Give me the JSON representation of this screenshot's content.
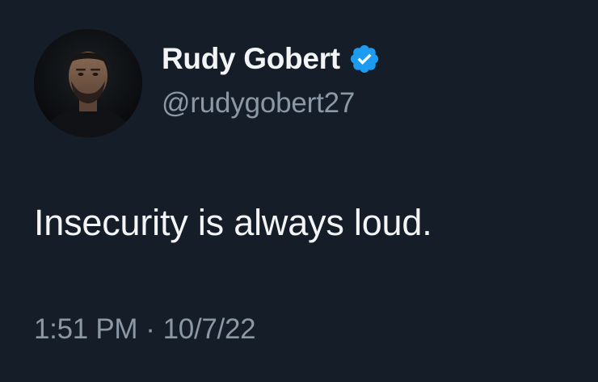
{
  "author": {
    "display_name": "Rudy Gobert",
    "handle": "@rudygobert27",
    "verified_icon": "verified-badge-icon",
    "avatar": "profile-photo"
  },
  "tweet": {
    "text": "Insecurity is always loud."
  },
  "meta": {
    "time": "1:51 PM",
    "separator": "·",
    "date": "10/7/22"
  },
  "colors": {
    "background": "#151d28",
    "primary_text": "#f2f4f5",
    "secondary_text": "#8b98a5",
    "verified_blue": "#1d9bf0"
  }
}
